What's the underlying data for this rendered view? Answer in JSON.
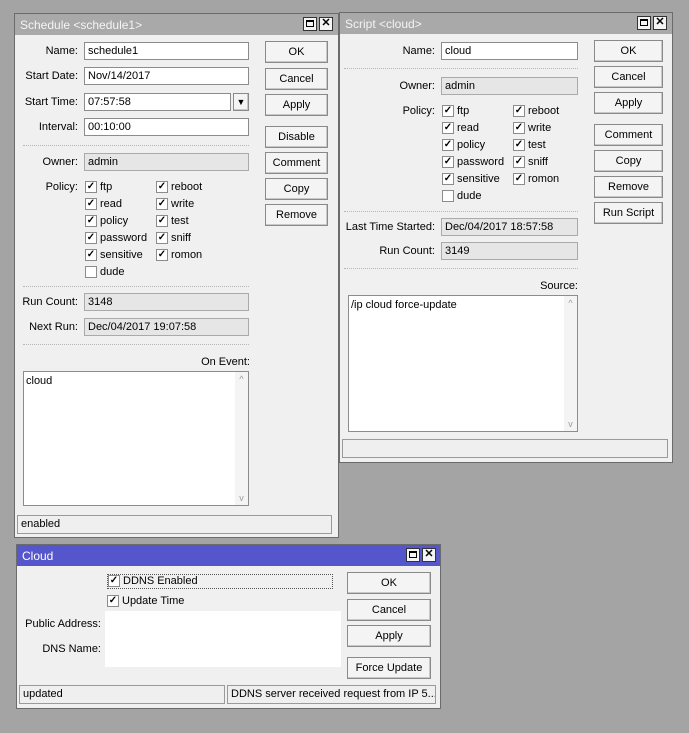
{
  "schedule": {
    "title": "Schedule <schedule1>",
    "name_label": "Name:",
    "name": "schedule1",
    "start_date_label": "Start Date:",
    "start_date": "Nov/14/2017",
    "start_time_label": "Start Time:",
    "start_time": "07:57:58",
    "interval_label": "Interval:",
    "interval": "00:10:00",
    "owner_label": "Owner:",
    "owner": "admin",
    "policy_label": "Policy:",
    "policies": [
      {
        "label": "ftp",
        "checked": true
      },
      {
        "label": "reboot",
        "checked": true
      },
      {
        "label": "read",
        "checked": true
      },
      {
        "label": "write",
        "checked": true
      },
      {
        "label": "policy",
        "checked": true
      },
      {
        "label": "test",
        "checked": true
      },
      {
        "label": "password",
        "checked": true
      },
      {
        "label": "sniff",
        "checked": true
      },
      {
        "label": "sensitive",
        "checked": true
      },
      {
        "label": "romon",
        "checked": true
      },
      {
        "label": "dude",
        "checked": false
      }
    ],
    "run_count_label": "Run Count:",
    "run_count": "3148",
    "next_run_label": "Next Run:",
    "next_run": "Dec/04/2017 19:07:58",
    "on_event_label": "On Event:",
    "on_event": "cloud",
    "status": "enabled",
    "buttons": {
      "ok": "OK",
      "cancel": "Cancel",
      "apply": "Apply",
      "disable": "Disable",
      "comment": "Comment",
      "copy": "Copy",
      "remove": "Remove"
    }
  },
  "script": {
    "title": "Script <cloud>",
    "name_label": "Name:",
    "name": "cloud",
    "owner_label": "Owner:",
    "owner": "admin",
    "policy_label": "Policy:",
    "policies": [
      {
        "label": "ftp",
        "checked": true
      },
      {
        "label": "reboot",
        "checked": true
      },
      {
        "label": "read",
        "checked": true
      },
      {
        "label": "write",
        "checked": true
      },
      {
        "label": "policy",
        "checked": true
      },
      {
        "label": "test",
        "checked": true
      },
      {
        "label": "password",
        "checked": true
      },
      {
        "label": "sniff",
        "checked": true
      },
      {
        "label": "sensitive",
        "checked": true
      },
      {
        "label": "romon",
        "checked": true
      },
      {
        "label": "dude",
        "checked": false
      }
    ],
    "last_started_label": "Last Time Started:",
    "last_started": "Dec/04/2017 18:57:58",
    "run_count_label": "Run Count:",
    "run_count": "3149",
    "source_label": "Source:",
    "source": "/ip cloud force-update",
    "buttons": {
      "ok": "OK",
      "cancel": "Cancel",
      "apply": "Apply",
      "comment": "Comment",
      "copy": "Copy",
      "remove": "Remove",
      "run_script": "Run Script"
    }
  },
  "cloud": {
    "title": "Cloud",
    "ddns_enabled_label": "DDNS Enabled",
    "ddns_enabled": true,
    "update_time_label": "Update Time",
    "update_time": true,
    "public_address_label": "Public Address:",
    "public_address": "",
    "dns_name_label": "DNS Name:",
    "dns_name": "",
    "status_left": "updated",
    "status_right": "DDNS server received request from IP 5....",
    "buttons": {
      "ok": "OK",
      "cancel": "Cancel",
      "apply": "Apply",
      "force_update": "Force Update"
    }
  },
  "colors": {
    "active_title": "#5555cc",
    "inactive_title": "#a9a9a9",
    "desktop": "#a4a4a4"
  }
}
